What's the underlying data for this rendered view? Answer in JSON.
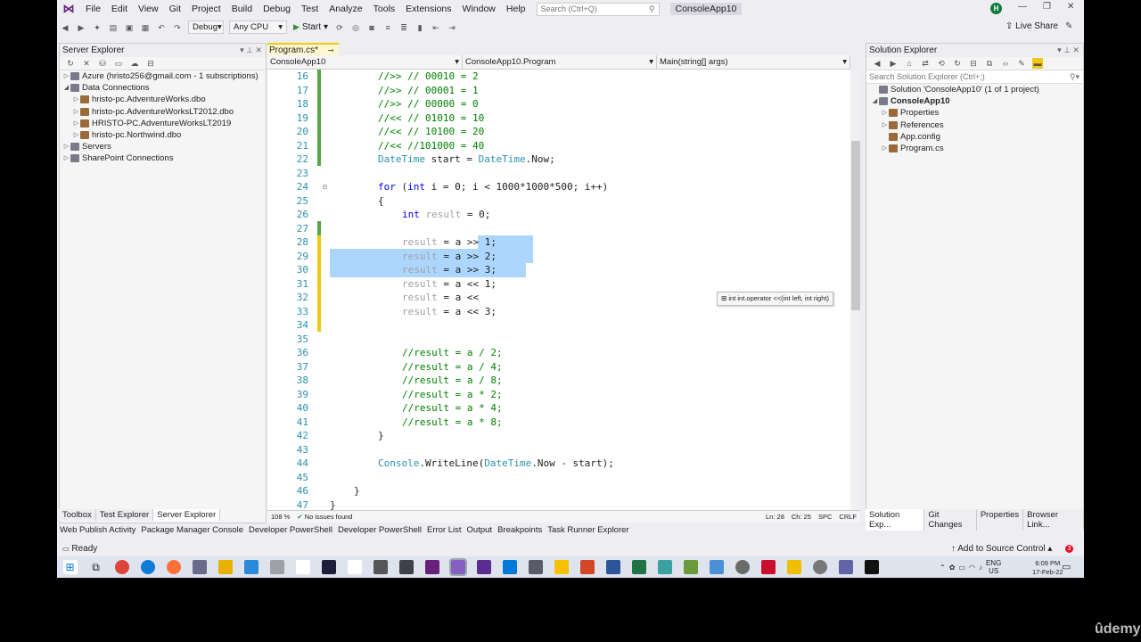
{
  "menu": {
    "items": [
      "File",
      "Edit",
      "View",
      "Git",
      "Project",
      "Build",
      "Debug",
      "Test",
      "Analyze",
      "Tools",
      "Extensions",
      "Window",
      "Help"
    ],
    "search_placeholder": "Search (Ctrl+Q)",
    "app_title": "ConsoleApp10",
    "avatar_initial": "H"
  },
  "toolbar": {
    "config": "Debug",
    "platform": "Any CPU",
    "start_label": "Start",
    "live_share": "Live Share"
  },
  "server_explorer": {
    "title": "Server Explorer",
    "items": [
      {
        "label": "Azure (hristo256@gmail.com - 1 subscriptions)",
        "level": 0,
        "arrow": "▷"
      },
      {
        "label": "Data Connections",
        "level": 0,
        "arrow": "◢"
      },
      {
        "label": "hristo-pc.AdventureWorks.dbo",
        "level": 1,
        "arrow": "▷"
      },
      {
        "label": "hristo-pc.AdventureWorksLT2012.dbo",
        "level": 1,
        "arrow": "▷"
      },
      {
        "label": "HRISTO-PC.AdventureWorksLT2019",
        "level": 1,
        "arrow": "▷"
      },
      {
        "label": "hristo-pc.Northwind.dbo",
        "level": 1,
        "arrow": "▷"
      },
      {
        "label": "Servers",
        "level": 0,
        "arrow": "▷"
      },
      {
        "label": "SharePoint Connections",
        "level": 0,
        "arrow": "▷"
      }
    ],
    "tabs": [
      "Toolbox",
      "Test Explorer",
      "Server Explorer"
    ]
  },
  "editor": {
    "tab_label": "Program.cs*",
    "nav_project": "ConsoleApp10",
    "nav_class": "ConsoleApp10.Program",
    "nav_member": "Main(string[] args)",
    "lines": [
      {
        "n": "16",
        "t": "//>> // 00010 = 2",
        "indent": 2,
        "c": "cm"
      },
      {
        "n": "17",
        "t": "//>> // 00001 = 1",
        "indent": 2,
        "c": "cm"
      },
      {
        "n": "18",
        "t": "//>> // 00000 = 0",
        "indent": 2,
        "c": "cm"
      },
      {
        "n": "19",
        "t": "//<< // 01010 = 10",
        "indent": 2,
        "c": "cm"
      },
      {
        "n": "20",
        "t": "//<< // 10100 = 20",
        "indent": 2,
        "c": "cm"
      },
      {
        "n": "21",
        "t": "//<< //101000 = 40",
        "indent": 2,
        "c": "cm"
      },
      {
        "n": "22",
        "t": "DateTime start = DateTime.Now;",
        "indent": 2,
        "c": "dt"
      },
      {
        "n": "23",
        "t": "",
        "indent": 2,
        "c": ""
      },
      {
        "n": "24",
        "t": "for (int i = 0; i < 1000*1000*500; i++)",
        "indent": 2,
        "c": "for"
      },
      {
        "n": "25",
        "t": "{",
        "indent": 2,
        "c": ""
      },
      {
        "n": "26",
        "t": "int result = 0;",
        "indent": 3,
        "c": "int"
      },
      {
        "n": "27",
        "t": "",
        "indent": 3,
        "c": ""
      },
      {
        "n": "28",
        "t": "result = a >> 1;",
        "indent": 3,
        "c": "res"
      },
      {
        "n": "29",
        "t": "result = a >> 2;",
        "indent": 3,
        "c": "res"
      },
      {
        "n": "30",
        "t": "result = a >> 3;",
        "indent": 3,
        "c": "res"
      },
      {
        "n": "31",
        "t": "result = a << 1;",
        "indent": 3,
        "c": "res"
      },
      {
        "n": "32",
        "t": "result = a <<",
        "indent": 3,
        "c": "res"
      },
      {
        "n": "33",
        "t": "result = a << 3;",
        "indent": 3,
        "c": "res"
      },
      {
        "n": "34",
        "t": "",
        "indent": 3,
        "c": ""
      },
      {
        "n": "35",
        "t": "",
        "indent": 3,
        "c": ""
      },
      {
        "n": "36",
        "t": "//result = a / 2;",
        "indent": 3,
        "c": "cm"
      },
      {
        "n": "37",
        "t": "//result = a / 4;",
        "indent": 3,
        "c": "cm"
      },
      {
        "n": "38",
        "t": "//result = a / 8;",
        "indent": 3,
        "c": "cm"
      },
      {
        "n": "39",
        "t": "//result = a * 2;",
        "indent": 3,
        "c": "cm"
      },
      {
        "n": "40",
        "t": "//result = a * 4;",
        "indent": 3,
        "c": "cm"
      },
      {
        "n": "41",
        "t": "//result = a * 8;",
        "indent": 3,
        "c": "cm"
      },
      {
        "n": "42",
        "t": "}",
        "indent": 2,
        "c": ""
      },
      {
        "n": "43",
        "t": "",
        "indent": 2,
        "c": ""
      },
      {
        "n": "44",
        "t": "Console.WriteLine(DateTime.Now - start);",
        "indent": 2,
        "c": "wl"
      },
      {
        "n": "45",
        "t": "",
        "indent": 2,
        "c": ""
      },
      {
        "n": "46",
        "t": "}",
        "indent": 1,
        "c": ""
      },
      {
        "n": "47",
        "t": "}",
        "indent": 0,
        "c": ""
      }
    ],
    "tooltip": "int int.operator <<(int left, int right)",
    "zoom": "108 %",
    "issues": "No issues found",
    "ln": "Ln: 28",
    "ch": "Ch: 25",
    "spc": "SPC",
    "crlf": "CRLF"
  },
  "solution_explorer": {
    "title": "Solution Explorer",
    "search_placeholder": "Search Solution Explorer (Ctrl+;)",
    "items": [
      {
        "label": "Solution 'ConsoleApp10' (1 of 1 project)",
        "level": 0,
        "arrow": ""
      },
      {
        "label": "ConsoleApp10",
        "level": 0,
        "arrow": "◢",
        "bold": true
      },
      {
        "label": "Properties",
        "level": 1,
        "arrow": "▷"
      },
      {
        "label": "References",
        "level": 1,
        "arrow": "▷"
      },
      {
        "label": "App.config",
        "level": 1,
        "arrow": ""
      },
      {
        "label": "Program.cs",
        "level": 1,
        "arrow": "▷"
      }
    ],
    "tabs": [
      "Solution Exp...",
      "Git Changes",
      "Properties",
      "Browser Link..."
    ]
  },
  "bottom_tabs": [
    "Web Publish Activity",
    "Package Manager Console",
    "Developer PowerShell",
    "Developer PowerShell",
    "Error List",
    "Output",
    "Breakpoints",
    "Task Runner Explorer"
  ],
  "status": {
    "ready": "Ready",
    "source_control": "↑ Add to Source Control ▴",
    "notifications": "3"
  },
  "taskbar": {
    "lang": "ENG",
    "region": "US",
    "time": "6:09 PM",
    "date": "17-Feb-22"
  },
  "watermark": "ûdemy"
}
